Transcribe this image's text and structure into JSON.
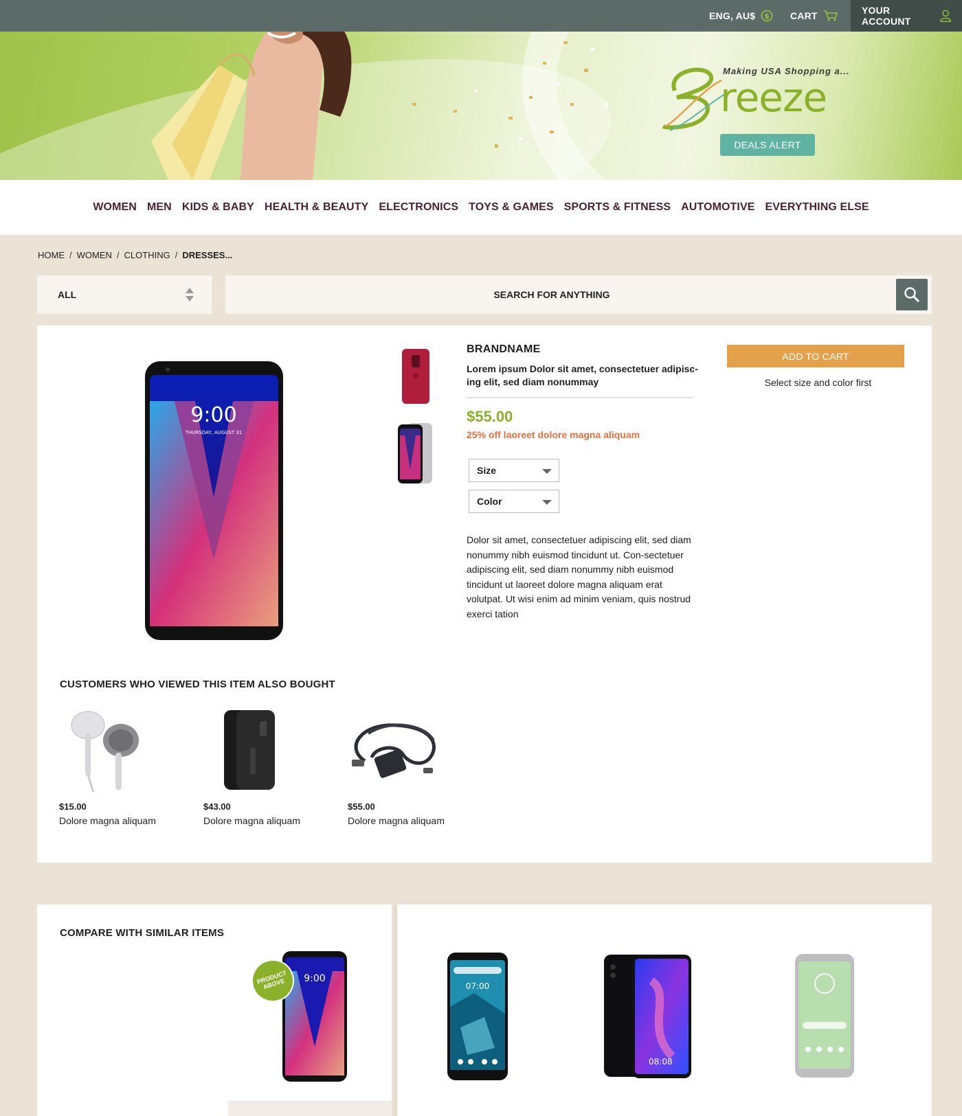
{
  "topbar": {
    "language_currency": "ENG, AU$",
    "cart_label": "CART",
    "account_label": "YOUR ACCOUNT"
  },
  "banner": {
    "tagline": "Making USA Shopping a...",
    "logo_text": "Breeze",
    "deals_button": "DEALS ALERT"
  },
  "categories": [
    "WOMEN",
    "MEN",
    "KIDS & BABY",
    "HEALTH & BEAUTY",
    "ELECTRONICS",
    "TOYS & GAMES",
    "SPORTS & FITNESS",
    "AUTOMOTIVE",
    "EVERYTHING ELSE"
  ],
  "breadcrumb": [
    "HOME",
    "WOMEN",
    "CLOTHING",
    "DRESSES..."
  ],
  "search": {
    "category_value": "ALL",
    "placeholder": "SEARCH FOR ANYTHING"
  },
  "product": {
    "screen_time": "9:00",
    "screen_date": "THURSDAY, AUGUST 31",
    "brand": "BRANDNAME",
    "title": "Lorem ipsum Dolor sit amet, consectetuer adipisc-ing elit, sed diam nonummay",
    "price": "$55.00",
    "discount": "25% off laoreet dolore magna aliquam",
    "size_label": "Size",
    "color_label": "Color",
    "description": "Dolor sit amet, consectetuer adipiscing elit, sed diam nonummy nibh euismod tincidunt ut. Con-sectetuer adipiscing elit, sed diam nonummy nibh euismod tincidunt ut laoreet dolore magna aliquam erat volutpat. Ut wisi enim ad minim veniam, quis nostrud exerci tation",
    "add_to_cart": "ADD TO CART",
    "cart_note": "Select size and color first"
  },
  "also_bought": {
    "title": "CUSTOMERS WHO VIEWED THIS ITEM ALSO BOUGHT",
    "items": [
      {
        "price": "$15.00",
        "name": "Dolore magna aliquam",
        "icon": "earphones"
      },
      {
        "price": "$43.00",
        "name": "Dolore magna aliquam",
        "icon": "phone-case"
      },
      {
        "price": "$55.00",
        "name": "Dolore magna aliquam",
        "icon": "charger-cable"
      }
    ]
  },
  "compare": {
    "title": "COMPARE WITH SIMILAR ITEMS",
    "badge_line1": "PRODUCT",
    "badge_line2": "ABOVE",
    "screen_times": [
      "9:00",
      "07:00",
      "08:08"
    ]
  },
  "colors": {
    "topbar": "#5c6b67",
    "nav_text": "#4a2233",
    "price_green": "#8bb12a",
    "discount_orange": "#e76f3f",
    "add_to_cart": "#e3a14b",
    "deals_alert": "#5fb3a0",
    "page_bg": "#ebe3d6"
  }
}
